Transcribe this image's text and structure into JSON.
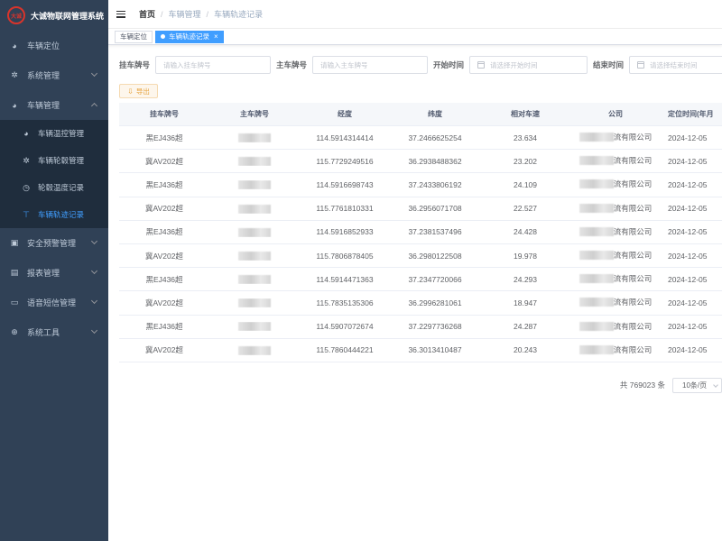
{
  "app": {
    "title": "大诚物联网管理系统",
    "logo_text": "大诚"
  },
  "sidebar": {
    "items": [
      {
        "label": "车辆定位",
        "icon": "dashboard-icon"
      },
      {
        "label": "系统管理",
        "icon": "gear-icon"
      },
      {
        "label": "车辆管理",
        "icon": "dashboard-icon",
        "expanded": true
      },
      {
        "label": "安全预警管理",
        "icon": "warning-icon"
      },
      {
        "label": "报表管理",
        "icon": "report-icon"
      },
      {
        "label": "语音短信管理",
        "icon": "message-icon"
      },
      {
        "label": "系统工具",
        "icon": "tool-icon"
      }
    ],
    "sub_items": [
      {
        "label": "车辆温控管理",
        "icon": "dashboard-icon"
      },
      {
        "label": "车辆轮毂管理",
        "icon": "gear-icon"
      },
      {
        "label": "轮毂温度记录",
        "icon": "clock-icon"
      },
      {
        "label": "车辆轨迹记录",
        "icon": "track-icon",
        "active": true
      }
    ]
  },
  "breadcrumb": {
    "home": "首页",
    "level1": "车辆管理",
    "level2": "车辆轨迹记录"
  },
  "tags": {
    "tag1": "车辆定位",
    "tag2": "车辆轨迹记录",
    "close": "×"
  },
  "filters": {
    "trailer_label": "挂车牌号",
    "trailer_placeholder": "请输入挂车牌号",
    "main_label": "主车牌号",
    "main_placeholder": "请输入主车牌号",
    "start_label": "开始时间",
    "start_placeholder": "请选择开始时间",
    "end_label": "结束时间",
    "end_placeholder": "请选择结束时间"
  },
  "toolbar": {
    "export_label": "导出"
  },
  "table": {
    "headers": [
      "挂车牌号",
      "主车牌号",
      "经度",
      "纬度",
      "相对车速",
      "公司",
      "定位时间(年月"
    ],
    "company_suffix": "流有限公司",
    "time_prefix": "2024-12-05",
    "rows": [
      {
        "trailer": "黑EJ436超",
        "lng": "114.5914314414",
        "lat": "37.2466625254",
        "speed": "23.634"
      },
      {
        "trailer": "冀AV202超",
        "lng": "115.7729249516",
        "lat": "36.2938488362",
        "speed": "23.202"
      },
      {
        "trailer": "黑EJ436超",
        "lng": "114.5916698743",
        "lat": "37.2433806192",
        "speed": "24.109"
      },
      {
        "trailer": "冀AV202超",
        "lng": "115.7761810331",
        "lat": "36.2956071708",
        "speed": "22.527"
      },
      {
        "trailer": "黑EJ436超",
        "lng": "114.5916852933",
        "lat": "37.2381537496",
        "speed": "24.428"
      },
      {
        "trailer": "冀AV202超",
        "lng": "115.7806878405",
        "lat": "36.2980122508",
        "speed": "19.978"
      },
      {
        "trailer": "黑EJ436超",
        "lng": "114.5914471363",
        "lat": "37.2347720066",
        "speed": "24.293"
      },
      {
        "trailer": "冀AV202超",
        "lng": "115.7835135306",
        "lat": "36.2996281061",
        "speed": "18.947"
      },
      {
        "trailer": "黑EJ436超",
        "lng": "114.5907072674",
        "lat": "37.2297736268",
        "speed": "24.287"
      },
      {
        "trailer": "冀AV202超",
        "lng": "115.7860444221",
        "lat": "36.3013410487",
        "speed": "20.243"
      }
    ]
  },
  "pagination": {
    "total": "共 769023 条",
    "page_size": "10条/页"
  },
  "colors": {
    "sidebar_bg": "#304156",
    "submenu_bg": "#1f2d3d",
    "accent": "#409eff",
    "warning": "#e6a23c"
  }
}
